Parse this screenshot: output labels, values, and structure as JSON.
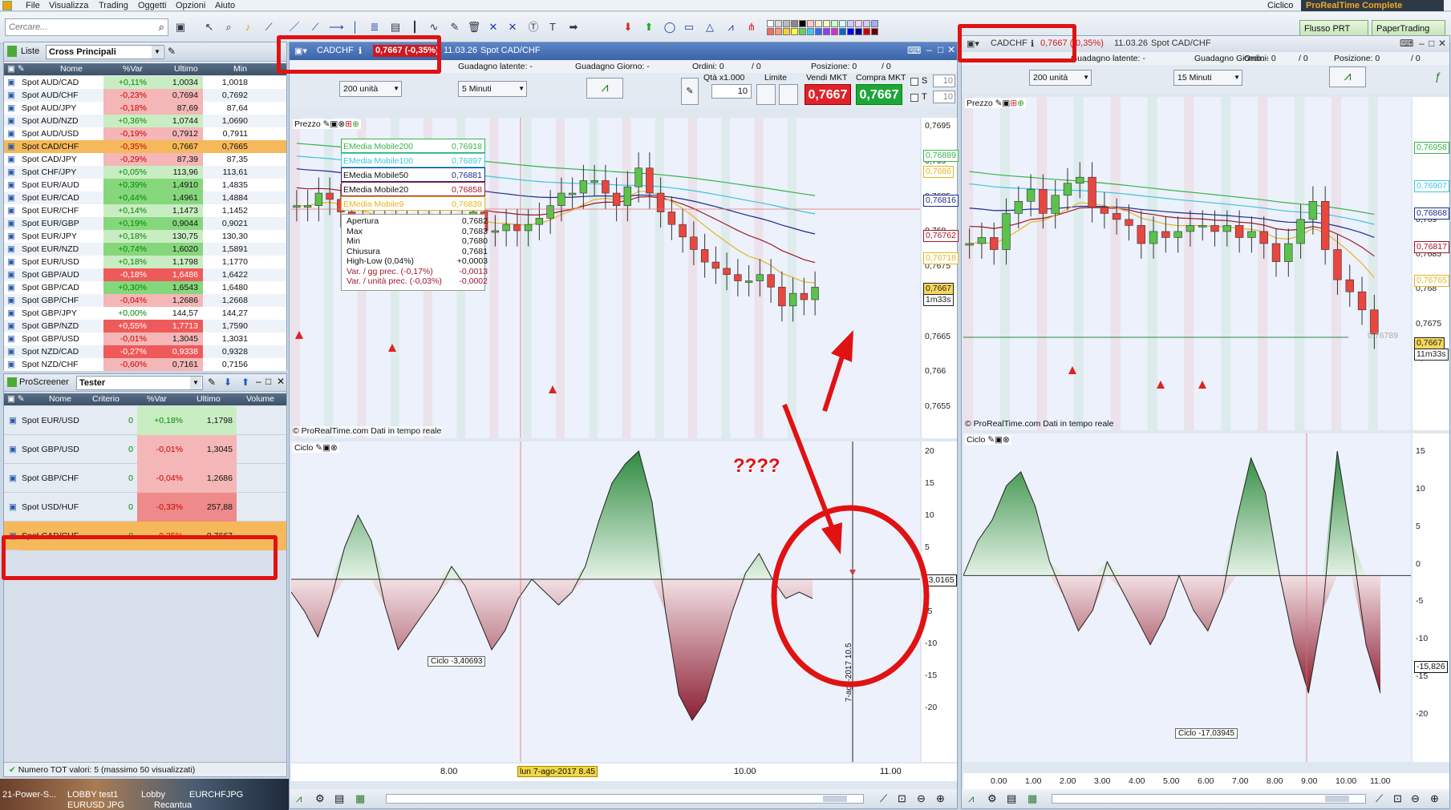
{
  "menu": [
    "File",
    "Visualizza",
    "Trading",
    "Oggetti",
    "Opzioni",
    "Aiuto"
  ],
  "topright": {
    "ciclico": "Ciclico",
    "brand": "ProRealTime Complete",
    "flusso": "Flusso PRT",
    "paper": "PaperTrading"
  },
  "search": {
    "placeholder": "Cercare..."
  },
  "lists": {
    "label": "Liste",
    "select": "Cross Principali",
    "cols": [
      "Nome",
      "%Var",
      "Ultimo",
      "Min"
    ],
    "rows": [
      [
        "Spot AUD/CAD",
        "+0,11%",
        "1,0034",
        "1,0018",
        "g1"
      ],
      [
        "Spot AUD/CHF",
        "-0,23%",
        "0,7694",
        "0,7692",
        "r1"
      ],
      [
        "Spot AUD/JPY",
        "-0,18%",
        "87,69",
        "87,64",
        "r1"
      ],
      [
        "Spot AUD/NZD",
        "+0,36%",
        "1,0744",
        "1,0690",
        "g1"
      ],
      [
        "Spot AUD/USD",
        "-0,19%",
        "0,7912",
        "0,7911",
        "r1"
      ],
      [
        "Spot CAD/CHF",
        "-0,35%",
        "0,7667",
        "0,7665",
        "sel"
      ],
      [
        "Spot CAD/JPY",
        "-0,29%",
        "87,39",
        "87,35",
        "r1"
      ],
      [
        "Spot CHF/JPY",
        "+0,05%",
        "113,96",
        "113,61",
        "g1"
      ],
      [
        "Spot EUR/AUD",
        "+0,39%",
        "1,4910",
        "1,4835",
        "g2"
      ],
      [
        "Spot EUR/CAD",
        "+0,44%",
        "1,4961",
        "1,4884",
        "g2"
      ],
      [
        "Spot EUR/CHF",
        "+0,14%",
        "1,1473",
        "1,1452",
        "g1"
      ],
      [
        "Spot EUR/GBP",
        "+0,19%",
        "0,9044",
        "0,9021",
        "g2"
      ],
      [
        "Spot EUR/JPY",
        "+0,18%",
        "130,75",
        "130,30",
        "g1"
      ],
      [
        "Spot EUR/NZD",
        "+0,74%",
        "1,6020",
        "1,5891",
        "g2"
      ],
      [
        "Spot EUR/USD",
        "+0,18%",
        "1,1798",
        "1,1770",
        "g1"
      ],
      [
        "Spot GBP/AUD",
        "-0,18%",
        "1,6486",
        "1,6422",
        "r2"
      ],
      [
        "Spot GBP/CAD",
        "+0,30%",
        "1,6543",
        "1,6480",
        "g2"
      ],
      [
        "Spot GBP/CHF",
        "-0,04%",
        "1,2686",
        "1,2668",
        "r1"
      ],
      [
        "Spot GBP/JPY",
        "+0,00%",
        "144,57",
        "144,27",
        "n"
      ],
      [
        "Spot GBP/NZD",
        "+0,55%",
        "1,7713",
        "1,7590",
        "r2"
      ],
      [
        "Spot GBP/USD",
        "-0,01%",
        "1,3045",
        "1,3031",
        "r1"
      ],
      [
        "Spot NZD/CAD",
        "-0,27%",
        "0,9338",
        "0,9328",
        "r2"
      ],
      [
        "Spot NZD/CHF",
        "-0,60%",
        "0,7161",
        "0,7156",
        "r1"
      ]
    ]
  },
  "screener": {
    "label": "ProScreener",
    "select": "Tester",
    "cols": [
      "Nome",
      "Criterio",
      "%Var",
      "Ultimo",
      "Volume"
    ],
    "rows": [
      [
        "Spot EUR/USD",
        "0",
        "+0,18%",
        "1,1798",
        "g"
      ],
      [
        "Spot GBP/USD",
        "0",
        "-0,01%",
        "1,3045",
        "r"
      ],
      [
        "Spot GBP/CHF",
        "0",
        "-0,04%",
        "1,2686",
        "r"
      ],
      [
        "Spot USD/HUF",
        "0",
        "-0,33%",
        "257,88",
        "r2"
      ],
      [
        "Spot CAD/CHF",
        "0",
        "-0,35%",
        "0,7667",
        "sel"
      ]
    ],
    "footer": "Numero TOT valori: 5 (massimo 50 visualizzati)"
  },
  "taskbar": [
    "21-Power-S...",
    "LOBBY test1",
    "Lobby",
    "EURCHFJPG",
    "EURUSD JPG",
    "Recantua"
  ],
  "chart1": {
    "symbol": "CADCHF",
    "price_badge": "0,7667 (-0,35%)",
    "time": "11.03.26",
    "name": "Spot CAD/CHF",
    "guad_latente": "Guadagno latente:  -",
    "guad_giorno": "Guadagno Giorno:  -",
    "ordini": "Ordini: 0",
    "ordini2": "/ 0",
    "posizione": "Posizione: 0",
    "posizione2": "/ 0",
    "units": "200 unità",
    "timeframe": "5 Minuti",
    "qta_label": "Qtà x1.000",
    "qta": "10",
    "limite": "Limite",
    "vendi": "Vendi MKT",
    "compra": "Compra MKT",
    "vendi_price": "0,7667",
    "compra_price": "0,7667",
    "s": "S",
    "t": "T",
    "s_val": "10",
    "t_val": "10",
    "prezzo": "Prezzo",
    "ciclo": "Ciclo",
    "legend": [
      {
        "name": "EMedia Mobile200",
        "value": "0,76918",
        "color": "#38b24a"
      },
      {
        "name": "EMedia Mobile100",
        "value": "0,76897",
        "color": "#3cc6d8"
      },
      {
        "name": "EMedia Mobile50",
        "value": "0,76881",
        "color": "#1c2a8c"
      },
      {
        "name": "EMedia Mobile20",
        "value": "0,76858",
        "color": "#a0172a"
      },
      {
        "name": "EMedia Mobile9",
        "value": "0,76839",
        "color": "#e6b422"
      }
    ],
    "ohlc": [
      [
        "Apertura",
        "0,7682"
      ],
      [
        "Max",
        "0,7683"
      ],
      [
        "Min",
        "0,7680"
      ],
      [
        "Chiusura",
        "0,7681"
      ],
      [
        "High-Low (0,04%)",
        "+0,0003"
      ],
      [
        "Var. / gg prec. (-0,17%)",
        "-0,0013"
      ],
      [
        "Var. / unità prec. (-0,03%)",
        "-0,0002"
      ]
    ],
    "price_axis": [
      "0,7695",
      "0,769",
      "0,7685",
      "0,768",
      "0,7675",
      "0,767",
      "0,7665",
      "0,766",
      "0,7655"
    ],
    "price_tags": [
      {
        "v": "0,76889",
        "c": "#38b24a"
      },
      {
        "v": "0,7686",
        "c": "#e6b422"
      },
      {
        "v": "0,76816",
        "c": "#1c2a8c"
      },
      {
        "v": "0,76762",
        "c": "#a0172a"
      },
      {
        "v": "0,76718",
        "c": "#e6b422"
      },
      {
        "v": "0,7667",
        "c": "#222"
      },
      {
        "v": "1m33s",
        "c": "#222"
      }
    ],
    "cycle_axis": [
      "20",
      "15",
      "10",
      "5",
      "0",
      "-5",
      "-10",
      "-15",
      "-20"
    ],
    "cycle_tag": "-3,0165",
    "cycle_label": "Ciclo   -3,40693",
    "credit": "© ProRealTime.com  Dati in tempo reale",
    "xaxis": [
      "8.00",
      "10.00",
      "11.00"
    ],
    "xhighlight": "lun 7-ago-2017 8.45",
    "vertical_date": "7-ago-2017 10.5",
    "annot": "????",
    "close_values": [
      0.7684,
      0.7684,
      0.7686,
      0.7685,
      0.7683,
      0.7682,
      0.7681,
      0.768,
      0.7681,
      0.7681,
      0.7682,
      0.7682,
      0.768,
      0.7682,
      0.7681,
      0.7682,
      0.7683,
      0.768,
      0.768,
      0.7681,
      0.768,
      0.7681,
      0.7682,
      0.7684,
      0.7686,
      0.7686,
      0.7688,
      0.7688,
      0.7686,
      0.7684,
      0.7687,
      0.769,
      0.7686,
      0.7683,
      0.7681,
      0.7679,
      0.7677,
      0.7675,
      0.7674,
      0.7673,
      0.7672,
      0.7672,
      0.7673,
      0.7671,
      0.7668,
      0.767,
      0.7669,
      0.7671
    ],
    "cycle_values": [
      -2,
      -5,
      -9,
      -3,
      5,
      10,
      6,
      -4,
      -11,
      -8,
      -5,
      -2,
      2,
      -1,
      -6,
      -11,
      -8,
      -3,
      0,
      -2,
      -4,
      -2,
      2,
      9,
      15,
      18,
      20,
      12,
      -5,
      -18,
      -22,
      -19,
      -12,
      -5,
      1,
      4,
      0,
      -3,
      -2,
      -3
    ]
  },
  "chart2": {
    "symbol": "CADCHF",
    "price_badge": "0,7667 (-0,35%)",
    "time": "11.03.26",
    "name": "Spot CAD/CHF",
    "guad_latente": "Guadagno latente:  -",
    "guad_giorno": "Guadagno Giorno:  -",
    "ordini": "Ordini: 0",
    "ordini2": "/ 0",
    "posizione": "Posizione: 0",
    "posizione2": "/ 0",
    "units": "200 unità",
    "timeframe": "15 Minuti",
    "prezzo": "Prezzo",
    "ciclo": "Ciclo",
    "credit": "© ProRealTime.com  Dati in tempo reale",
    "price_axis": [
      "0,77",
      "0,7695",
      "0,769",
      "0,7685",
      "0,768",
      "0,7675",
      "0,767"
    ],
    "price_tags": [
      {
        "v": "0,76958",
        "c": "#38b24a"
      },
      {
        "v": "0,76907",
        "c": "#3cc6d8"
      },
      {
        "v": "0,76868",
        "c": "#1c2a8c"
      },
      {
        "v": "0,76817",
        "c": "#a0172a"
      },
      {
        "v": "0,76765",
        "c": "#e6b422"
      },
      {
        "v": "0,7667",
        "c": "#222"
      },
      {
        "v": "11m33s",
        "c": "#222"
      }
    ],
    "inline_tag": "0,76789",
    "cycle_axis": [
      "15",
      "10",
      "5",
      "0",
      "-5",
      "-10",
      "-15",
      "-20"
    ],
    "cycle_tag": "-15,826",
    "cycle_label": "Ciclo   -17,03945",
    "xaxis": [
      "0.00",
      "1.00",
      "2.00",
      "3.00",
      "4.00",
      "5.00",
      "6.00",
      "7.00",
      "8.00",
      "9.00",
      "10.00",
      "11.00"
    ],
    "close_values": [
      0.7683,
      0.7684,
      0.7682,
      0.7688,
      0.769,
      0.7692,
      0.7688,
      0.7691,
      0.7693,
      0.7694,
      0.7689,
      0.7688,
      0.7687,
      0.7686,
      0.7683,
      0.7685,
      0.7684,
      0.7685,
      0.7686,
      0.7686,
      0.7685,
      0.7686,
      0.7684,
      0.7685,
      0.7683,
      0.768,
      0.7683,
      0.7687,
      0.769,
      0.7682,
      0.7677,
      0.7675,
      0.7672,
      0.7668
    ],
    "cycle_values": [
      0,
      5,
      8,
      13,
      15,
      10,
      2,
      -3,
      -8,
      -5,
      2,
      -2,
      -6,
      -10,
      -6,
      0,
      -5,
      -8,
      -3,
      8,
      17,
      12,
      0,
      -10,
      -17,
      -5,
      18,
      5,
      -10,
      -17
    ]
  }
}
